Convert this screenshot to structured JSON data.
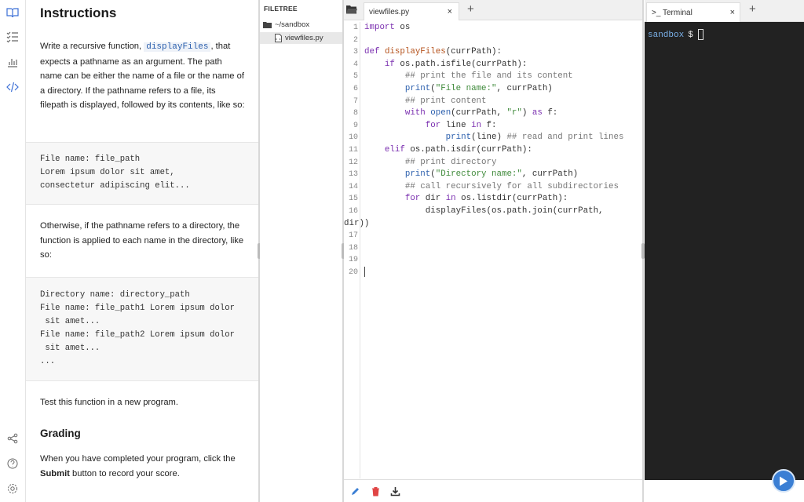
{
  "instructions": {
    "title": "Instructions",
    "p1_pre": "Write a recursive function,",
    "p1_code": "displayFiles",
    "p1_post": ", that expects a pathname as an argument. The path name can be either the name of a file or the name of a directory. If the pathname refers to a file, its filepath is displayed, followed by its contents, like so:",
    "code1": [
      "File name: file_path",
      "Lorem ipsum dolor sit amet,",
      "consectetur adipiscing elit..."
    ],
    "p2": "Otherwise, if the pathname refers to a directory, the function is applied to each name in the directory, like so:",
    "code2": [
      "Directory name: directory_path",
      "File name: file_path1 Lorem ipsum dolor",
      " sit amet...",
      "File name: file_path2 Lorem ipsum dolor",
      " sit amet...",
      "..."
    ],
    "p3": "Test this function in a new program.",
    "grading_title": "Grading",
    "grading_pre": "When you have completed your program, click the",
    "grading_bold": "Submit",
    "grading_post": "button to record your score."
  },
  "filetree": {
    "header": "FILETREE",
    "folder": "~/sandbox",
    "file": "viewfiles.py"
  },
  "editor": {
    "tab_label": "viewfiles.py",
    "close_glyph": "×",
    "plus_glyph": "+",
    "line_numbers": [
      "1",
      "2",
      "3",
      "4",
      "5",
      "6",
      "7",
      "8",
      "9",
      "10",
      "11",
      "12",
      "13",
      "14",
      "15",
      "16",
      "",
      "17",
      "18",
      "19",
      "20"
    ]
  },
  "terminal": {
    "tab_label": ">_ Terminal",
    "close_glyph": "×",
    "plus_glyph": "+",
    "prompt_dir": "sandbox",
    "prompt_symbol": "$"
  },
  "colors": {
    "accent": "#3b7fd4",
    "keyword": "#7b30b0",
    "string": "#3f8a3a",
    "comment": "#777777"
  },
  "icons": [
    "book-icon",
    "checklist-icon",
    "chart-icon",
    "code-icon",
    "share-icon",
    "help-icon",
    "settings-icon",
    "folder-icon",
    "file-icon",
    "pencil-icon",
    "trash-icon",
    "download-icon",
    "play-icon"
  ]
}
